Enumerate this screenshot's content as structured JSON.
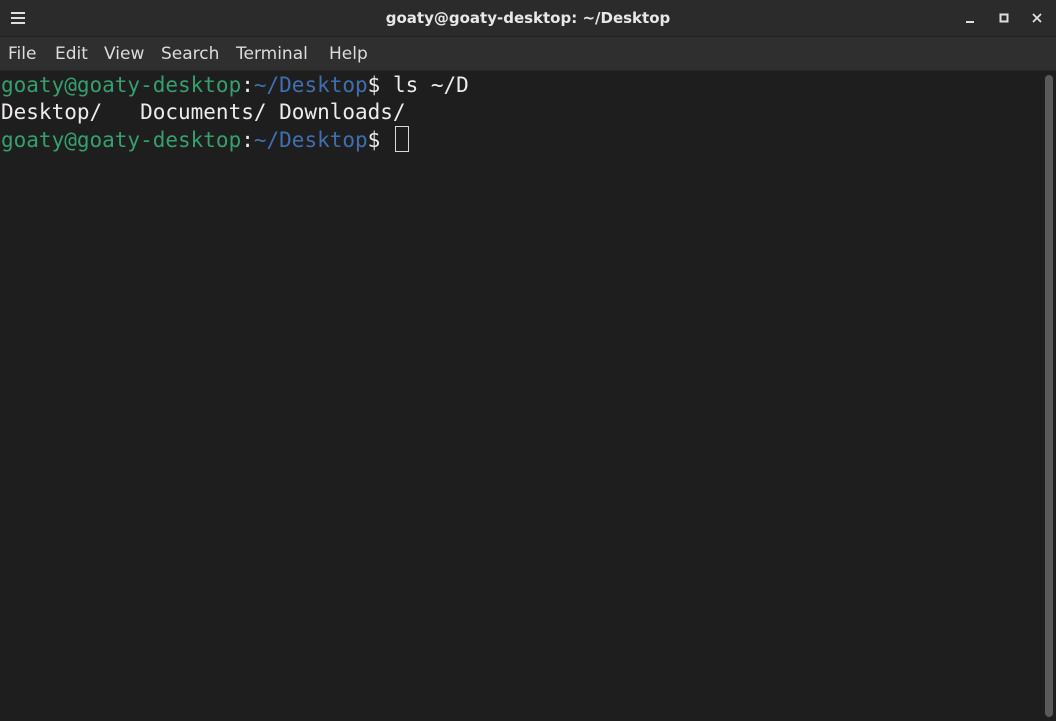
{
  "window": {
    "title": "goaty@goaty-desktop: ~/Desktop",
    "menu_icon": "hamburger-menu-icon",
    "controls": {
      "minimize_icon": "minimize-icon",
      "maximize_icon": "maximize-icon",
      "close_icon": "close-icon"
    }
  },
  "menubar": {
    "items": [
      "File",
      "Edit",
      "View",
      "Search",
      "Terminal",
      "Help"
    ]
  },
  "terminal": {
    "colors": {
      "background": "#1e1e1e",
      "user_host": "#35a06e",
      "path": "#3f6fb0",
      "text": "#ececec"
    },
    "lines": [
      {
        "user": "goaty@goaty-desktop",
        "sep": ":",
        "path": "~/Desktop",
        "prompt": "$ ",
        "command": "ls ~/D"
      },
      {
        "output": "Desktop/   Documents/ Downloads/"
      },
      {
        "user": "goaty@goaty-desktop",
        "sep": ":",
        "path": "~/Desktop",
        "prompt": "$ ",
        "command": ""
      }
    ]
  }
}
